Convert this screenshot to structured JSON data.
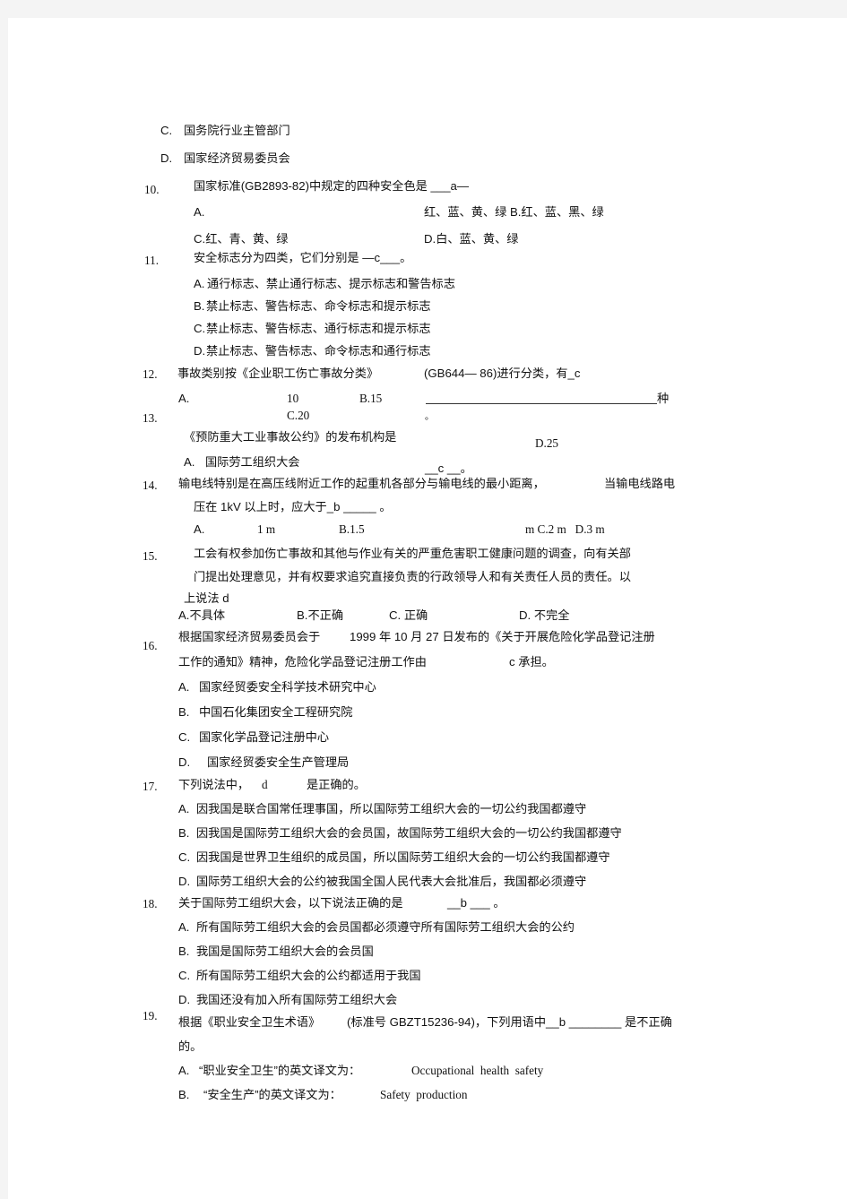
{
  "page": {
    "background_color": "#f4f4f4",
    "paper_color": "#ffffff",
    "text_color": "#111111"
  },
  "document": {
    "type": "scanned-exam-multiple-choice",
    "language": "zh-CN",
    "carryover_options": [
      {
        "label": "C.",
        "text": "国务院行业主管部门"
      },
      {
        "label": "D.",
        "text": "国家经济贸易委员会"
      }
    ],
    "questions": [
      {
        "number": "10.",
        "stem": "国家标准(GB2893-82)中规定的四种安全色是 ___a—",
        "options": [
          {
            "label": "A.",
            "text": ""
          },
          {
            "label": "",
            "text": "红、蓝、黄、绿 B.红、蓝、黑、绿"
          },
          {
            "label": "",
            "text": "C.红、青、黄、绿"
          },
          {
            "label": "",
            "text": "D.白、蓝、黄、绿"
          }
        ]
      },
      {
        "number": "11.",
        "stem": "安全标志分为四类，它们分别是 —c___。",
        "options": [
          {
            "label": "A.",
            "text": "通行标志、禁止通行标志、提示标志和警告标志"
          },
          {
            "label": "B.",
            "text": "禁止标志、警告标志、命令标志和提示标志"
          },
          {
            "label": "C.",
            "text": "禁止标志、警告标志、通行标志和提示标志"
          },
          {
            "label": "D.",
            "text": "禁止标志、警告标志、命令标志和通行标志"
          }
        ]
      },
      {
        "number": "12.",
        "stem_left": "事故类别按《企业职工伤亡事故分类》",
        "stem_right": "(GB644— 86)进行分类，有_c",
        "trailing_unit": "种",
        "trailing_period": "。",
        "options": [
          {
            "label": "A.",
            "text": ""
          },
          {
            "label": "",
            "text": "10"
          },
          {
            "label": "B.15",
            "text": ""
          },
          {
            "label": "C.20",
            "text": ""
          },
          {
            "label": "D.25",
            "text": ""
          }
        ]
      },
      {
        "number": "13.",
        "stem": "《预防重大工业事故公约》的发布机构是",
        "answer_blank": "__c __。",
        "options": [
          {
            "label": "A.",
            "text": "国际劳工组织大会"
          }
        ]
      },
      {
        "number": "14.",
        "stem_line1_a": "输电线特别是在高压线附近工作的起重机各部分与输电线的最小距离，",
        "stem_line1_b": "当输电线路电",
        "stem_line2": "压在 1kV 以上时，应大于_b _____ 。",
        "options": [
          {
            "label": "A.",
            "text": ""
          },
          {
            "label": "",
            "text": "1 m"
          },
          {
            "label": "B.1.5",
            "text": ""
          },
          {
            "label": "",
            "text": "m C.2 m   D.3 m"
          }
        ]
      },
      {
        "number": "15.",
        "stem_line1": "工会有权参加伤亡事故和其他与作业有关的严重危害职工健康问题的调查，向有关部",
        "stem_line2": "门提出处理意见，并有权要求追究直接负责的行政领导人和有关责任人员的责任。以",
        "stem_line3": "上说法 d",
        "options": [
          {
            "label": "A.不具体",
            "text": ""
          },
          {
            "label": "B.不正确",
            "text": ""
          },
          {
            "label": "C. 正确",
            "text": ""
          },
          {
            "label": "D. 不完全",
            "text": ""
          }
        ]
      },
      {
        "number": "16.",
        "stem_line1_a": "根据国家经济贸易委员会于",
        "stem_line1_b": "1999 年 10 月 27 日发布的《关于开展危险化学品登记注册",
        "stem_line2_a": "工作的通知》精神，危险化学品登记注册工作由",
        "stem_line2_b": "c 承担。",
        "options": [
          {
            "label": "A.",
            "text": "国家经贸委安全科学技术研究中心"
          },
          {
            "label": "B.",
            "text": "中国石化集团安全工程研究院"
          },
          {
            "label": "C.",
            "text": "国家化学品登记注册中心"
          },
          {
            "label": "D.",
            "text": "国家经贸委安全生产管理局"
          }
        ]
      },
      {
        "number": "17.",
        "stem_a": "下列说法中，",
        "stem_answer": "d",
        "stem_b": "是正确的。",
        "options": [
          {
            "label": "A.",
            "text": "因我国是联合国常任理事国，所以国际劳工组织大会的一切公约我国都遵守"
          },
          {
            "label": "B.",
            "text": "因我国是国际劳工组织大会的会员国，故国际劳工组织大会的一切公约我国都遵守"
          },
          {
            "label": "C.",
            "text": "因我国是世界卫生组织的成员国，所以国际劳工组织大会的一切公约我国都遵守"
          },
          {
            "label": "D.",
            "text": "国际劳工组织大会的公约被我国全国人民代表大会批准后，我国都必须遵守"
          }
        ]
      },
      {
        "number": "18.",
        "stem_a": "关于国际劳工组织大会，以下说法正确的是",
        "stem_b": "__b ___ 。",
        "options": [
          {
            "label": "A.",
            "text": "所有国际劳工组织大会的会员国都必须遵守所有国际劳工组织大会的公约"
          },
          {
            "label": "B.",
            "text": "我国是国际劳工组织大会的会员国"
          },
          {
            "label": "C.",
            "text": "所有国际劳工组织大会的公约都适用于我国"
          },
          {
            "label": "D.",
            "text": "我国还没有加入所有国际劳工组织大会"
          }
        ]
      },
      {
        "number": "19.",
        "stem_line1_a": "根据《职业安全卫生术语》",
        "stem_line1_b": "(标准号 GBZT15236-94)，下列用语中__b ________ 是不正确",
        "stem_line2": "的。",
        "options": [
          {
            "label": "A.",
            "text": "“职业安全卫生”的英文译文为："
          },
          {
            "label": "B.",
            "text": "“安全生产”的英文译文为："
          }
        ],
        "english_terms": [
          "Occupational  health  safety",
          "Safety  production"
        ]
      }
    ]
  }
}
